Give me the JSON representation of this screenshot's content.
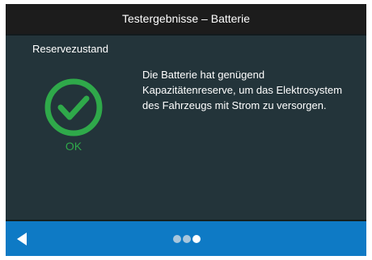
{
  "header": {
    "title": "Testergebnisse – Batterie"
  },
  "main": {
    "section_label": "Reservezustand",
    "status": {
      "icon": "check-circle-icon",
      "text": "OK",
      "color": "#2fa94a"
    },
    "description": "Die Batterie hat genügend Kapazitätenreserve, um das Elektrosystem des Fahrzeugs mit Strom zu versorgen."
  },
  "footer": {
    "back_icon": "back-arrow-icon",
    "pager": {
      "total": 3,
      "current": 3
    },
    "accent_color": "#0e7ac5"
  }
}
